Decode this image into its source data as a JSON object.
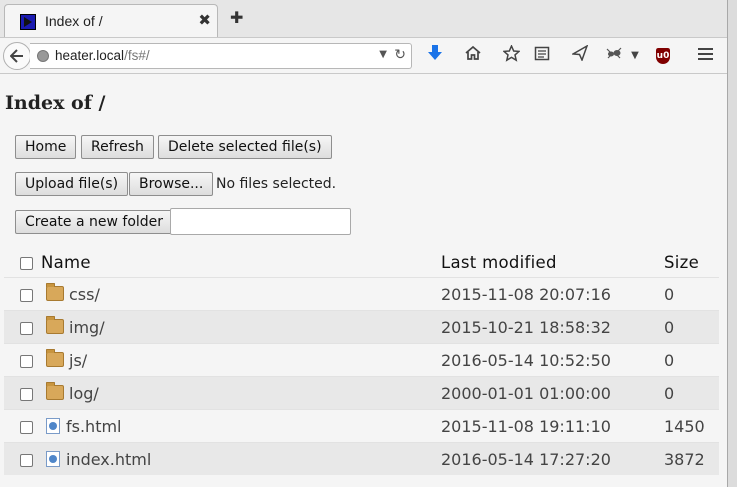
{
  "browser": {
    "tab_title": "Index of /",
    "tab_close": "✖",
    "new_tab": "✚",
    "url_host": "heater.local",
    "url_path": "/fs#/",
    "toolbar_icons": [
      "back-icon",
      "download-icon",
      "home-icon",
      "star-icon",
      "reading-list-icon",
      "send-icon",
      "ant-icon",
      "ublock-icon",
      "menu-icon"
    ]
  },
  "page": {
    "title": "Index of /",
    "buttons": {
      "home": "Home",
      "refresh": "Refresh",
      "delete": "Delete selected file(s)",
      "upload": "Upload file(s)",
      "browse": "Browse...",
      "create_folder": "Create a new folder"
    },
    "no_files": "No files selected.",
    "new_folder_value": "",
    "columns": {
      "name": "Name",
      "modified": "Last modified",
      "size": "Size"
    },
    "files": [
      {
        "type": "folder",
        "name": "css/",
        "modified": "2015-11-08 20:07:16",
        "size": "0"
      },
      {
        "type": "folder",
        "name": "img/",
        "modified": "2015-10-21 18:58:32",
        "size": "0"
      },
      {
        "type": "folder",
        "name": "js/",
        "modified": "2016-05-14 10:52:50",
        "size": "0"
      },
      {
        "type": "folder",
        "name": "log/",
        "modified": "2000-01-01 01:00:00",
        "size": "0"
      },
      {
        "type": "file",
        "name": "fs.html",
        "modified": "2015-11-08 19:11:10",
        "size": "1450"
      },
      {
        "type": "file",
        "name": "index.html",
        "modified": "2016-05-14 17:27:20",
        "size": "3872"
      }
    ]
  }
}
